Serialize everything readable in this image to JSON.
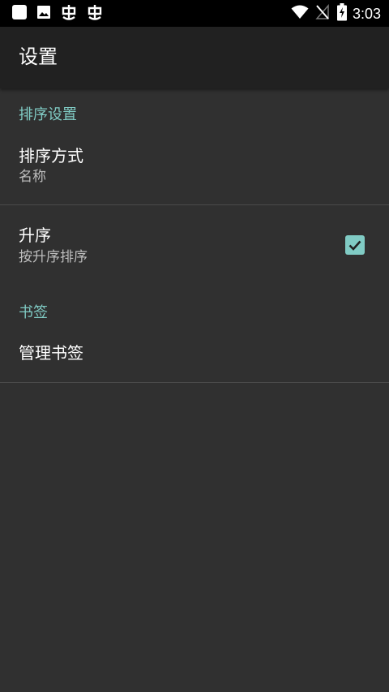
{
  "status_bar": {
    "time": "3:03",
    "left_icons": [
      "notification-square-icon",
      "image-icon",
      "app-icon",
      "app-icon"
    ],
    "right_icons": [
      "wifi-icon",
      "no-signal-icon",
      "battery-charging-icon"
    ]
  },
  "toolbar": {
    "title": "设置"
  },
  "sections": {
    "sort": {
      "header": "排序设置",
      "sort_method": {
        "title": "排序方式",
        "summary": "名称"
      },
      "ascending": {
        "title": "升序",
        "summary": "按升序排序",
        "checked": true
      }
    },
    "bookmarks": {
      "header": "书签",
      "manage": {
        "title": "管理书签"
      }
    }
  },
  "colors": {
    "background": "#303030",
    "toolbar": "#212121",
    "accent": "#80cbc4",
    "summary_text": "#bdbdbd",
    "divider": "#4a4a4a"
  }
}
